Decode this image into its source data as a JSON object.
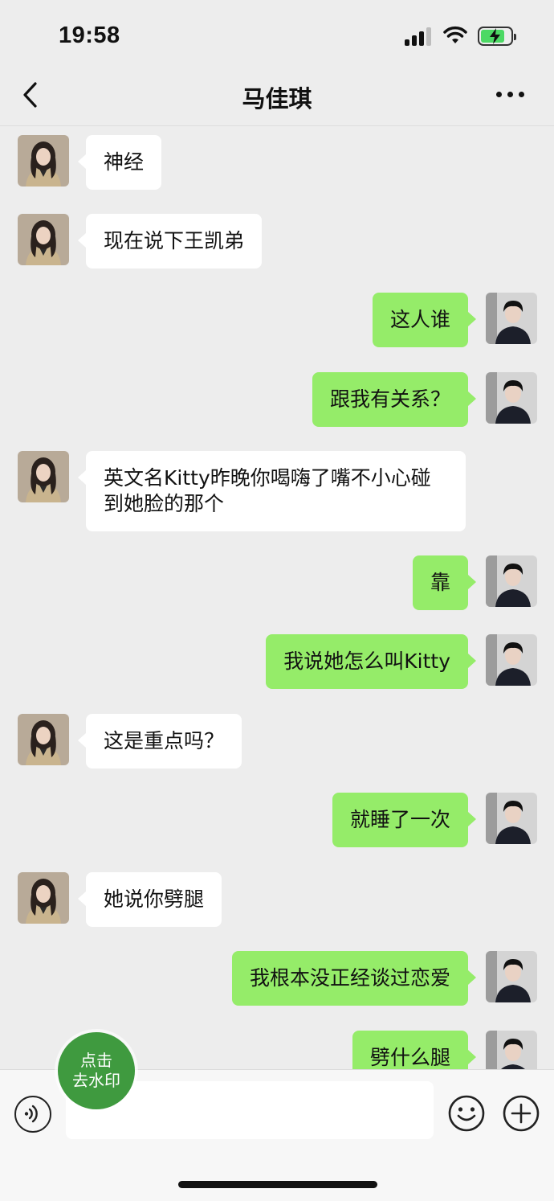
{
  "status_bar": {
    "time": "19:58"
  },
  "header": {
    "title": "马佳琪"
  },
  "messages": [
    {
      "side": "in",
      "text": "神经"
    },
    {
      "side": "in",
      "text": "现在说下王凯弟"
    },
    {
      "side": "out",
      "text": "这人谁"
    },
    {
      "side": "out",
      "text": "跟我有关系？"
    },
    {
      "side": "in",
      "text": "英文名Kitty昨晚你喝嗨了嘴不小心碰\n到她脸的那个"
    },
    {
      "side": "out",
      "text": "靠"
    },
    {
      "side": "out",
      "text": "我说她怎么叫Kitty"
    },
    {
      "side": "in",
      "text": "这是重点吗？"
    },
    {
      "side": "out",
      "text": "就睡了一次"
    },
    {
      "side": "in",
      "text": "她说你劈腿"
    },
    {
      "side": "out",
      "text": "我根本没正经谈过恋爱"
    },
    {
      "side": "out",
      "text": "劈什么腿"
    }
  ],
  "watermark_button": {
    "line1": "点击",
    "line2": "去水印"
  },
  "colors": {
    "outgoing": "#95ec69",
    "incoming": "#ffffff",
    "background": "#ededed"
  },
  "icons": [
    "back-chevron-icon",
    "more-icon",
    "voice-icon",
    "emoji-icon",
    "plus-icon",
    "signal-icon",
    "wifi-icon",
    "battery-charging-icon"
  ]
}
